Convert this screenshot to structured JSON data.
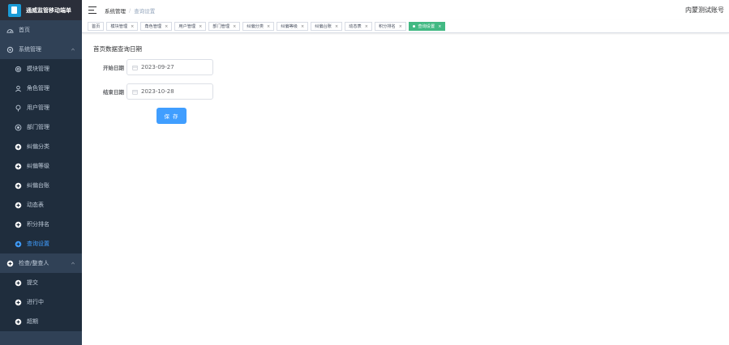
{
  "app": {
    "title": "通威监管移动端单"
  },
  "header": {
    "breadcrumb": [
      "系统管理",
      "查询设置"
    ],
    "user": "内蒙测试账号"
  },
  "sidebar": {
    "items": [
      {
        "label": "首页",
        "level": "top",
        "icon": "dashboard-icon"
      },
      {
        "label": "系统管理",
        "level": "top",
        "icon": "system-gear-icon",
        "expanded": true
      },
      {
        "label": "模块管理",
        "level": "sub",
        "icon": "module-icon"
      },
      {
        "label": "角色管理",
        "level": "sub",
        "icon": "user-icon"
      },
      {
        "label": "用户管理",
        "level": "sub",
        "icon": "bulb-icon"
      },
      {
        "label": "部门管理",
        "level": "sub",
        "icon": "dept-icon"
      },
      {
        "label": "纠偏分类",
        "level": "sub",
        "icon": "plus-circle-icon"
      },
      {
        "label": "纠偏等级",
        "level": "sub",
        "icon": "plus-circle-icon"
      },
      {
        "label": "纠偏台账",
        "level": "sub",
        "icon": "plus-circle-icon"
      },
      {
        "label": "动态表",
        "level": "sub",
        "icon": "plus-circle-icon"
      },
      {
        "label": "积分排名",
        "level": "sub",
        "icon": "plus-circle-icon"
      },
      {
        "label": "查询设置",
        "level": "sub",
        "icon": "plus-circle-icon",
        "active": true
      },
      {
        "label": "检查/整查人",
        "level": "top",
        "icon": "plus-circle-icon",
        "expanded": true
      },
      {
        "label": "提交",
        "level": "sub",
        "icon": "plus-circle-icon"
      },
      {
        "label": "进行中",
        "level": "sub",
        "icon": "plus-circle-icon"
      },
      {
        "label": "超期",
        "level": "sub",
        "icon": "plus-circle-icon"
      }
    ]
  },
  "tags": [
    {
      "label": "首页",
      "closable": false
    },
    {
      "label": "模块管理",
      "closable": true
    },
    {
      "label": "角色管理",
      "closable": true
    },
    {
      "label": "用户管理",
      "closable": true
    },
    {
      "label": "部门管理",
      "closable": true
    },
    {
      "label": "纠偏分类",
      "closable": true
    },
    {
      "label": "纠偏等级",
      "closable": true
    },
    {
      "label": "纠偏台账",
      "closable": true
    },
    {
      "label": "动态表",
      "closable": true
    },
    {
      "label": "积分排名",
      "closable": true
    },
    {
      "label": "查询设置",
      "closable": true,
      "active": true
    }
  ],
  "main": {
    "section_title": "首页数据查询日期",
    "start_label": "开始日期",
    "start_value": "2023-09-27",
    "end_label": "结束日期",
    "end_value": "2023-10-28",
    "save_label": "保 存"
  },
  "colors": {
    "sidebar_bg": "#304156",
    "active": "#409eff",
    "tag_active": "#42b983"
  }
}
